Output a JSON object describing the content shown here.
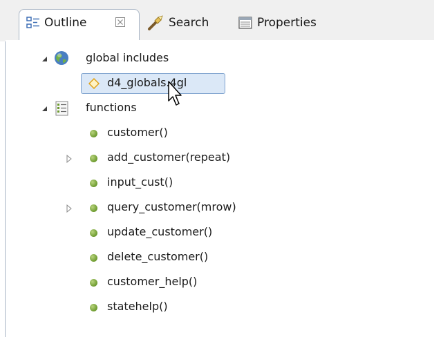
{
  "tabs": {
    "outline_label": "Outline",
    "outline_close": "⊠",
    "search_label": "Search",
    "properties_label": "Properties"
  },
  "tree": {
    "global_includes": {
      "label": "global includes",
      "expanded": true,
      "children": [
        {
          "label": "d4_globals.4gl",
          "selected": true
        }
      ]
    },
    "functions": {
      "label": "functions",
      "expanded": true,
      "children": [
        {
          "label": "customer()",
          "has_children": false
        },
        {
          "label": "add_customer(repeat)",
          "has_children": true
        },
        {
          "label": "input_cust()",
          "has_children": false
        },
        {
          "label": "query_customer(mrow)",
          "has_children": true
        },
        {
          "label": "update_customer()",
          "has_children": false
        },
        {
          "label": "delete_customer()",
          "has_children": false
        },
        {
          "label": "customer_help()",
          "has_children": false
        },
        {
          "label": "statehelp()",
          "has_children": false
        }
      ]
    }
  },
  "icons": {
    "outline": "outline-icon",
    "search": "search-flashlight-icon",
    "properties": "properties-icon",
    "globe": "globe-icon",
    "include_file": "diamond-icon",
    "functions": "functions-list-icon",
    "function": "green-dot-icon",
    "expanded": "triangle-down-icon",
    "collapsed": "triangle-right-icon"
  },
  "colors": {
    "selection_fill": "#dbe8f7",
    "selection_border": "#7da2ce",
    "tab_border": "#a7b4c4",
    "function_dot": "#6c9a2e"
  }
}
